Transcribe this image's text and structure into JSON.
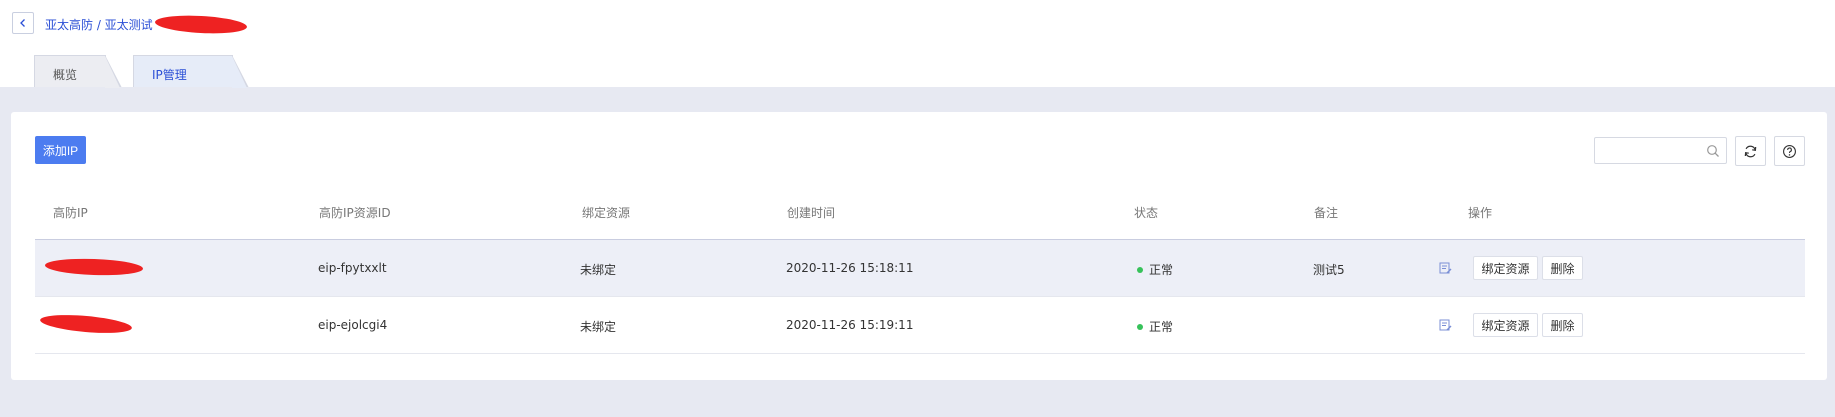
{
  "breadcrumb": {
    "text": "亚太高防 / 亚太测试"
  },
  "tabs": [
    {
      "label": "概览",
      "active": false
    },
    {
      "label": "IP管理",
      "active": true
    }
  ],
  "toolbar": {
    "add_label": "添加IP",
    "search_placeholder": ""
  },
  "table": {
    "headers": [
      "高防IP",
      "高防IP资源ID",
      "绑定资源",
      "创建时间",
      "状态",
      "备注",
      "操作"
    ],
    "rows": [
      {
        "ip": "",
        "resource_id": "eip-fpytxxlt",
        "bound": "未绑定",
        "created": "2020-11-26 15:18:11",
        "status": "正常",
        "note": "测试5",
        "bind_label": "绑定资源",
        "delete_label": "删除"
      },
      {
        "ip": "",
        "resource_id": "eip-ejolcgi4",
        "bound": "未绑定",
        "created": "2020-11-26 15:19:11",
        "status": "正常",
        "note": "",
        "bind_label": "绑定资源",
        "delete_label": "删除"
      }
    ]
  },
  "colors": {
    "accent": "#4c7cf0",
    "link": "#2b4fd6",
    "status_ok": "#37c25a",
    "redaction": "#ee2222"
  },
  "icons": [
    "chevron-left-icon",
    "search-icon",
    "refresh-icon",
    "help-icon",
    "edit-note-icon",
    "status-dot-icon"
  ]
}
